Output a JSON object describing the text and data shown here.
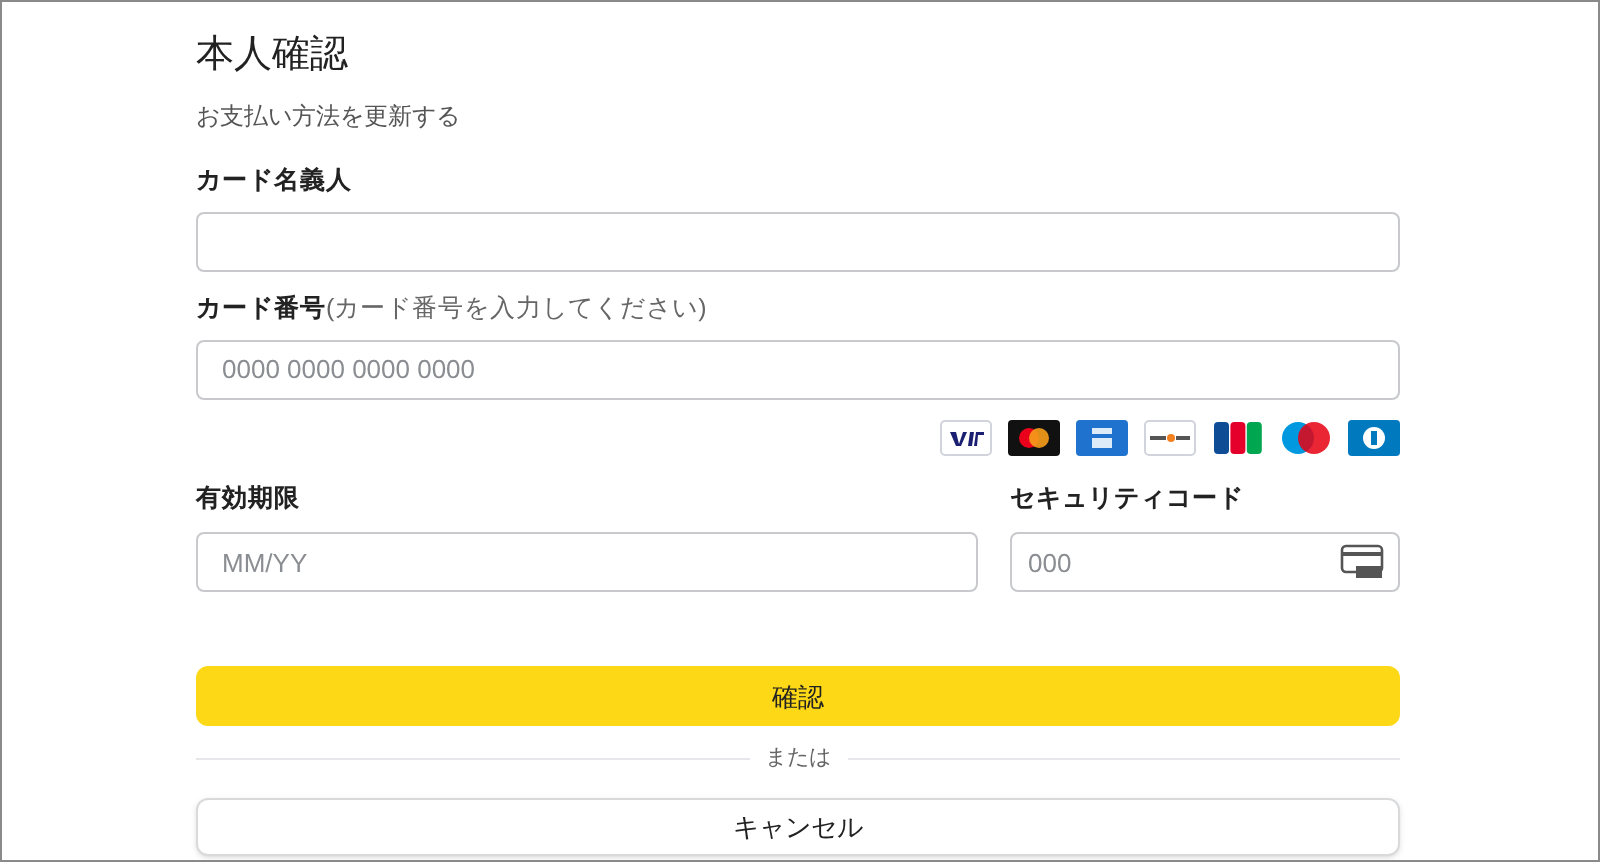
{
  "title": "本人確認",
  "subtitle": "お支払い方法を更新する",
  "cardholder": {
    "label": "カード名義人"
  },
  "card_number": {
    "label": "カード番号",
    "hint": "(カード番号を入力してください)",
    "placeholder": "0000 0000 0000 0000"
  },
  "card_brands": [
    {
      "kind": "visa"
    },
    {
      "kind": "mastercard"
    },
    {
      "kind": "amex"
    },
    {
      "kind": "discover"
    },
    {
      "kind": "jcb"
    },
    {
      "kind": "maestro"
    },
    {
      "kind": "diners"
    }
  ],
  "expiry": {
    "label": "有効期限",
    "placeholder": "MM/YY"
  },
  "security_code": {
    "label": "セキュリティコード",
    "placeholder": "000"
  },
  "confirm_button": "確認",
  "divider_text": "または",
  "cancel_button": "キャンセル"
}
